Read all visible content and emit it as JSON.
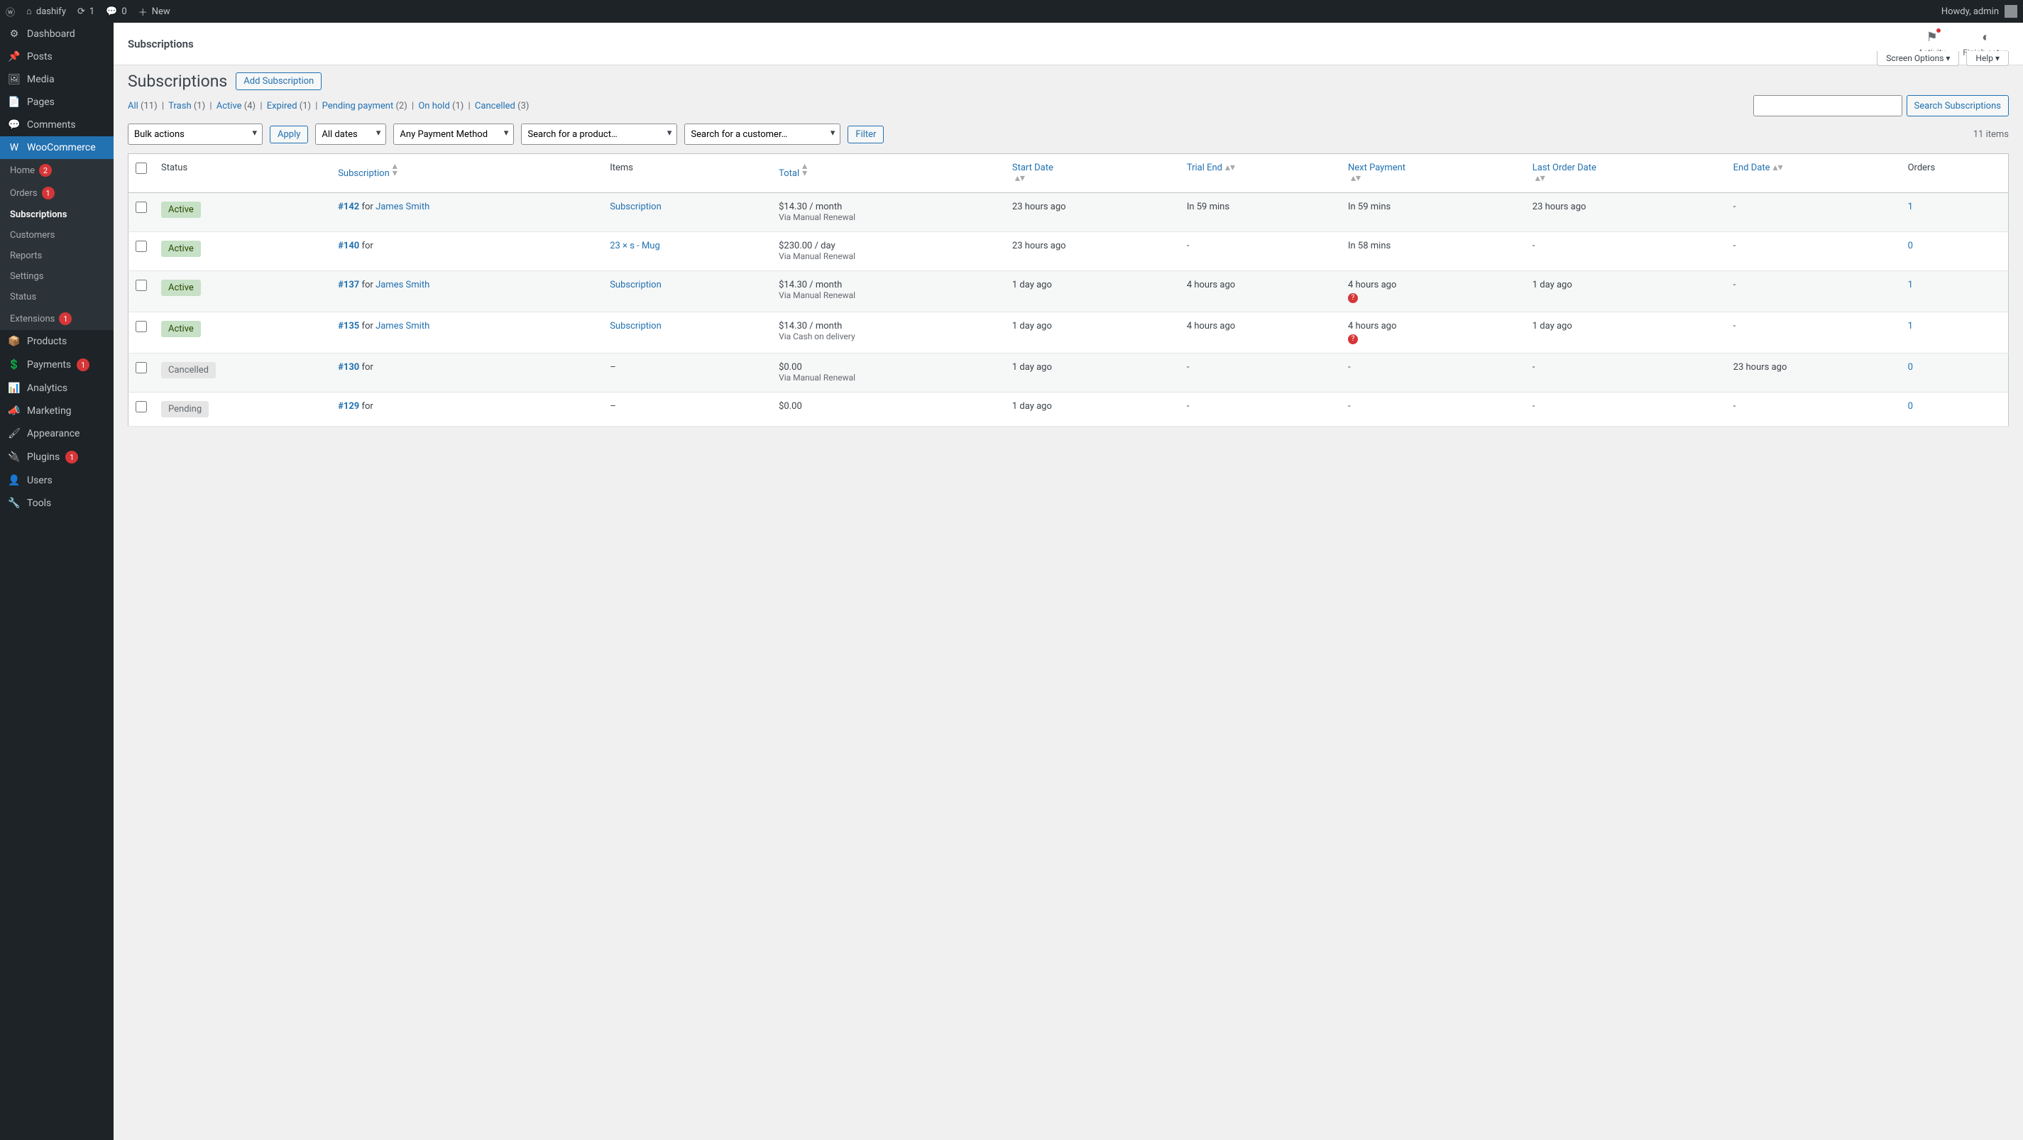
{
  "toolbar": {
    "site_name": "dashify",
    "updates": "1",
    "comments": "0",
    "new_label": "New",
    "howdy": "Howdy, admin"
  },
  "sidebar": {
    "items": [
      {
        "label": "Dashboard",
        "icon": "⚙"
      },
      {
        "label": "Posts",
        "icon": "📌"
      },
      {
        "label": "Media",
        "icon": "🖼"
      },
      {
        "label": "Pages",
        "icon": "📄"
      },
      {
        "label": "Comments",
        "icon": "💬"
      },
      {
        "label": "WooCommerce",
        "icon": "W",
        "current": true
      },
      {
        "label": "Products",
        "icon": "📦"
      },
      {
        "label": "Payments",
        "icon": "💲",
        "badge": "1"
      },
      {
        "label": "Analytics",
        "icon": "📊"
      },
      {
        "label": "Marketing",
        "icon": "📣"
      },
      {
        "label": "Appearance",
        "icon": "🖌"
      },
      {
        "label": "Plugins",
        "icon": "🔌",
        "badge": "1"
      },
      {
        "label": "Users",
        "icon": "👤"
      },
      {
        "label": "Tools",
        "icon": "🔧"
      }
    ],
    "submenu": [
      {
        "label": "Home",
        "badge": "2"
      },
      {
        "label": "Orders",
        "badge": "1"
      },
      {
        "label": "Subscriptions",
        "active": true
      },
      {
        "label": "Customers"
      },
      {
        "label": "Reports"
      },
      {
        "label": "Settings"
      },
      {
        "label": "Status"
      },
      {
        "label": "Extensions",
        "badge": "1"
      }
    ]
  },
  "topbar": {
    "title": "Subscriptions",
    "activity": "Activity",
    "finish": "Finish setup"
  },
  "page": {
    "heading": "Subscriptions",
    "add_button": "Add Subscription",
    "screen_options": "Screen Options ▾",
    "help": "Help ▾",
    "search_button": "Search Subscriptions",
    "bulk_actions": "Bulk actions",
    "apply": "Apply",
    "all_dates": "All dates",
    "any_payment": "Any Payment Method",
    "product_placeholder": "Search for a product…",
    "customer_placeholder": "Search for a customer…",
    "filter": "Filter",
    "items_count": "11 items"
  },
  "views": [
    {
      "label": "All",
      "count": "(11)"
    },
    {
      "label": "Trash",
      "count": "(1)"
    },
    {
      "label": "Active",
      "count": "(4)"
    },
    {
      "label": "Expired",
      "count": "(1)"
    },
    {
      "label": "Pending payment",
      "count": "(2)"
    },
    {
      "label": "On hold",
      "count": "(1)"
    },
    {
      "label": "Cancelled",
      "count": "(3)"
    }
  ],
  "columns": {
    "status": "Status",
    "subscription": "Subscription",
    "items": "Items",
    "total": "Total",
    "start": "Start Date",
    "trial": "Trial End",
    "next": "Next Payment",
    "last": "Last Order Date",
    "end": "End Date",
    "orders": "Orders"
  },
  "rows": [
    {
      "status": "Active",
      "id": "#142",
      "for": " for ",
      "cust": "James Smith",
      "items": "Subscription",
      "total": "$14.30 / month",
      "via": "Via Manual Renewal",
      "start": "23 hours ago",
      "trial": "In 59 mins",
      "next": "In 59 mins",
      "last": "23 hours ago",
      "end": "-",
      "orders": "1",
      "alert": false
    },
    {
      "status": "Active",
      "id": "#140",
      "for": " for",
      "cust": "",
      "items": "23 × s - Mug",
      "total": "$230.00 / day",
      "via": "Via Manual Renewal",
      "start": "23 hours ago",
      "trial": "-",
      "next": "In 58 mins",
      "last": "-",
      "end": "-",
      "orders": "0",
      "alert": false
    },
    {
      "status": "Active",
      "id": "#137",
      "for": " for ",
      "cust": "James Smith",
      "items": "Subscription",
      "total": "$14.30 / month",
      "via": "Via Manual Renewal",
      "start": "1 day ago",
      "trial": "4 hours ago",
      "next": "4 hours ago",
      "last": "1 day ago",
      "end": "-",
      "orders": "1",
      "alert": true
    },
    {
      "status": "Active",
      "id": "#135",
      "for": " for ",
      "cust": "James Smith",
      "items": "Subscription",
      "total": "$14.30 / month",
      "via": "Via Cash on delivery",
      "start": "1 day ago",
      "trial": "4 hours ago",
      "next": "4 hours ago",
      "last": "1 day ago",
      "end": "-",
      "orders": "1",
      "alert": true
    },
    {
      "status": "Cancelled",
      "id": "#130",
      "for": " for",
      "cust": "",
      "items": "–",
      "total": "$0.00",
      "via": "Via Manual Renewal",
      "start": "1 day ago",
      "trial": "-",
      "next": "-",
      "last": "-",
      "end": "23 hours ago",
      "orders": "0",
      "alert": false
    },
    {
      "status": "Pending",
      "id": "#129",
      "for": " for",
      "cust": "",
      "items": "–",
      "total": "$0.00",
      "via": "",
      "start": "1 day ago",
      "trial": "-",
      "next": "-",
      "last": "-",
      "end": "-",
      "orders": "0",
      "alert": false
    }
  ]
}
